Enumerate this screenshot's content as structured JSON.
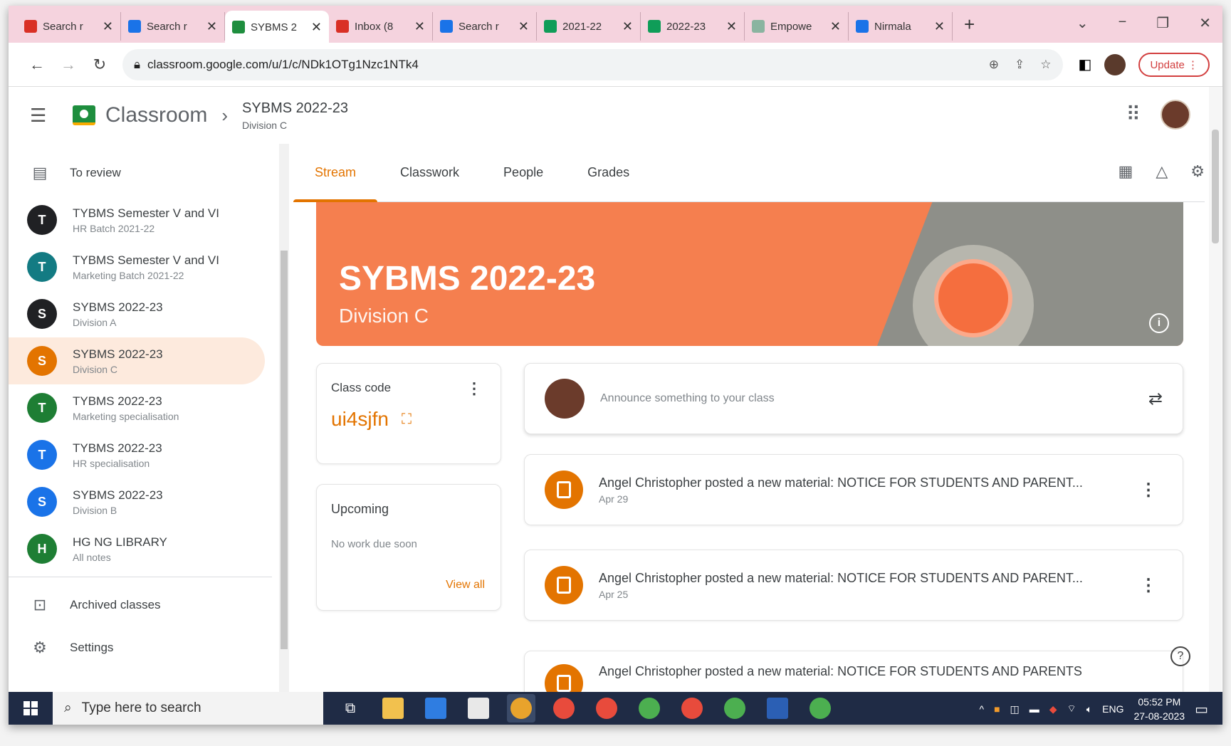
{
  "browser": {
    "tabs": [
      {
        "label": "Search r",
        "icon": "gmail-icon",
        "color": "#d93025"
      },
      {
        "label": "Search r",
        "icon": "drive-icon",
        "color": "#1a73e8"
      },
      {
        "label": "SYBMS 2",
        "icon": "classroom-icon",
        "color": "#1e8e3e"
      },
      {
        "label": "Inbox (8",
        "icon": "gmail-icon",
        "color": "#d93025"
      },
      {
        "label": "Search r",
        "icon": "drive-icon",
        "color": "#1a73e8"
      },
      {
        "label": "2021-22",
        "icon": "sheets-icon",
        "color": "#0f9d58"
      },
      {
        "label": "2022-23",
        "icon": "sheets-icon",
        "color": "#0f9d58"
      },
      {
        "label": "Empowe",
        "icon": "site-icon",
        "color": "#8ab4a0"
      },
      {
        "label": "Nirmala",
        "icon": "drive-icon",
        "color": "#1a73e8"
      }
    ],
    "active_tab": 2,
    "url": "classroom.google.com/u/1/c/NDk1OTg1Nzc1NTk4",
    "update_label": "Update"
  },
  "header": {
    "app_name": "Classroom",
    "class_title": "SYBMS 2022-23",
    "class_section": "Division C"
  },
  "sidebar": {
    "to_review": "To review",
    "classes": [
      {
        "letter": "T",
        "title": "TYBMS Semester V and VI",
        "sub": "HR Batch 2021-22",
        "color": "#202124"
      },
      {
        "letter": "T",
        "title": "TYBMS Semester V and VI",
        "sub": "Marketing Batch 2021-22",
        "color": "#137b83"
      },
      {
        "letter": "S",
        "title": "SYBMS 2022-23",
        "sub": "Division A",
        "color": "#202124"
      },
      {
        "letter": "S",
        "title": "SYBMS 2022-23",
        "sub": "Division C",
        "color": "#e37400"
      },
      {
        "letter": "T",
        "title": "TYBMS 2022-23",
        "sub": "Marketing specialisation",
        "color": "#1e7e34"
      },
      {
        "letter": "T",
        "title": "TYBMS 2022-23",
        "sub": "HR specialisation",
        "color": "#1a73e8"
      },
      {
        "letter": "S",
        "title": "SYBMS 2022-23",
        "sub": "Division B",
        "color": "#1a73e8"
      },
      {
        "letter": "H",
        "title": "HG NG LIBRARY",
        "sub": "All notes",
        "color": "#1e7e34"
      }
    ],
    "archived": "Archived classes",
    "settings": "Settings"
  },
  "tabs": [
    "Stream",
    "Classwork",
    "People",
    "Grades"
  ],
  "banner": {
    "title": "SYBMS 2022-23",
    "subtitle": "Division C"
  },
  "class_code": {
    "label": "Class code",
    "value": "ui4sjfn"
  },
  "upcoming": {
    "title": "Upcoming",
    "empty": "No work due soon",
    "view_all": "View all"
  },
  "announce": {
    "placeholder": "Announce something to your class"
  },
  "posts": [
    {
      "title": "Angel Christopher posted a new material: NOTICE FOR STUDENTS AND PARENT...",
      "date": "Apr 29"
    },
    {
      "title": "Angel Christopher posted a new material: NOTICE FOR STUDENTS AND PARENT...",
      "date": "Apr 25"
    },
    {
      "title": "Angel Christopher posted a new material: NOTICE FOR STUDENTS AND PARENTS",
      "date": ""
    }
  ],
  "taskbar": {
    "search_placeholder": "Type here to search",
    "lang": "ENG",
    "time": "05:52 PM",
    "date": "27-08-2023"
  }
}
